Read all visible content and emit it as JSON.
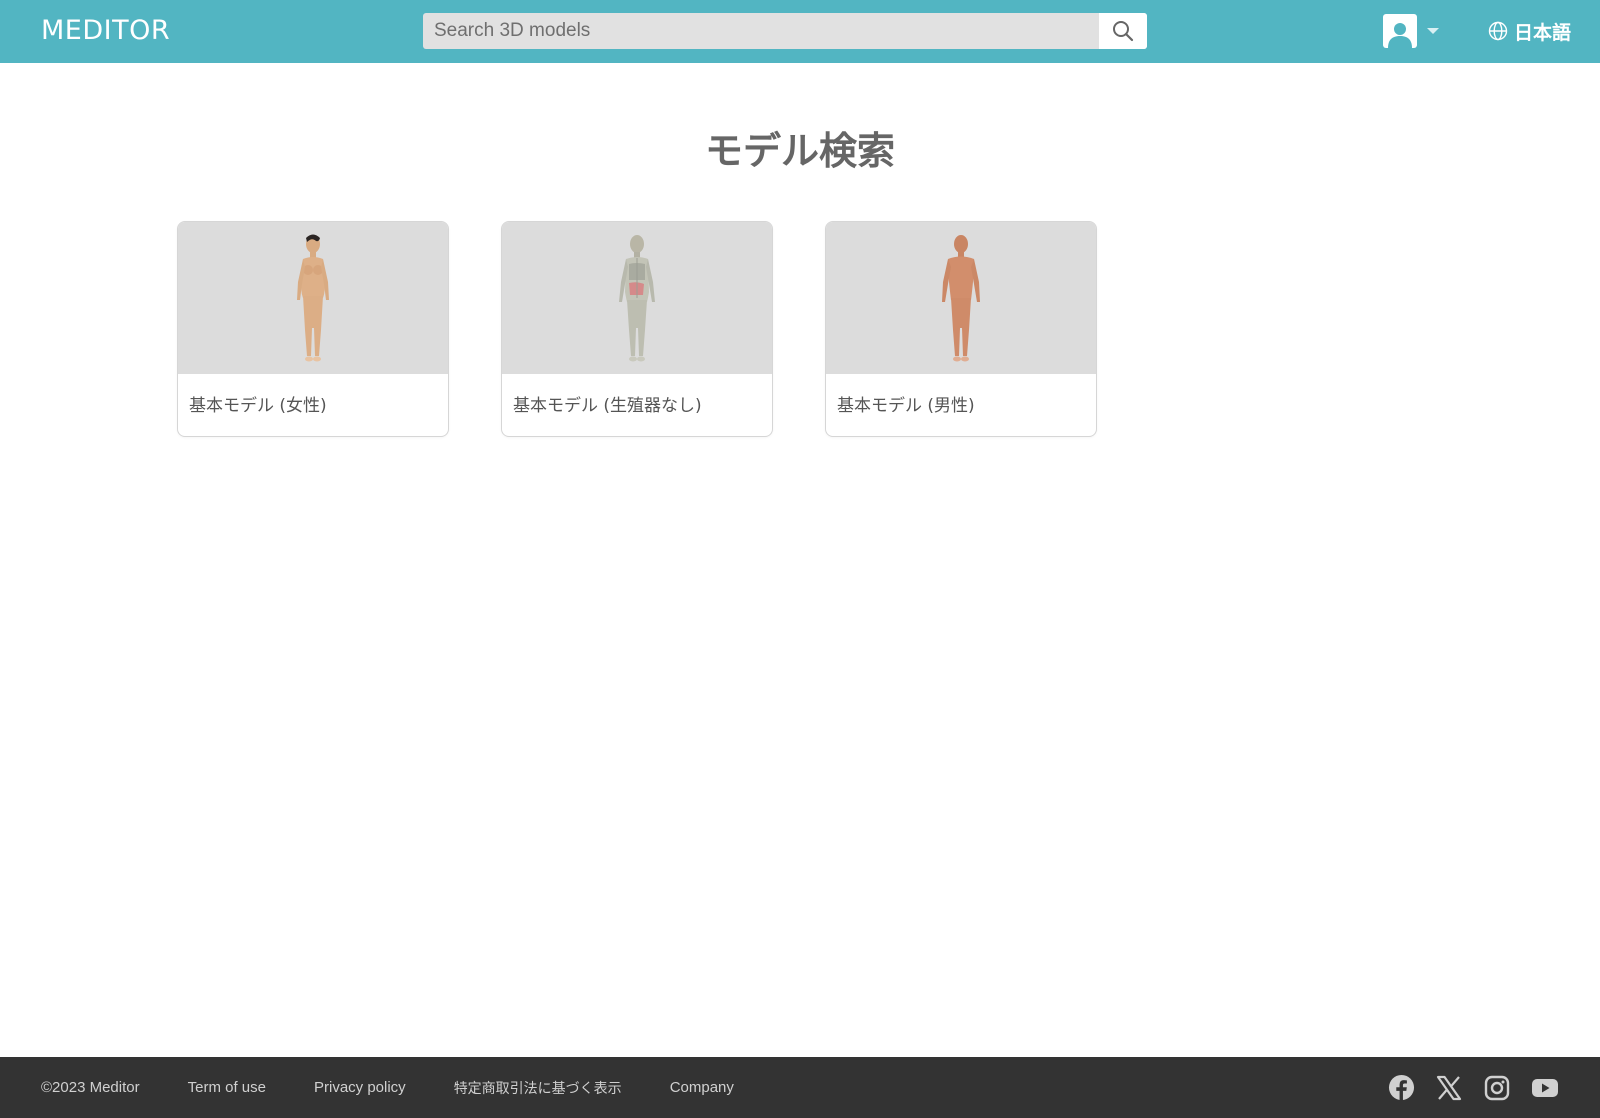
{
  "header": {
    "logo": "MEDITOR",
    "search": {
      "placeholder": "Search 3D models",
      "value": ""
    },
    "search_button_icon": "search-icon",
    "user_icon": "user-icon",
    "language": "日本語",
    "accent_color": "#52b5c2"
  },
  "main": {
    "title": "モデル検索",
    "cards": [
      {
        "label": "基本モデル (女性)",
        "thumbnail": "female-body-model"
      },
      {
        "label": "基本モデル (生殖器なし)",
        "thumbnail": "anatomy-body-model"
      },
      {
        "label": "基本モデル (男性)",
        "thumbnail": "male-body-model"
      }
    ]
  },
  "footer": {
    "copyright": "©2023 Meditor",
    "links": [
      "Term of use",
      "Privacy policy",
      "特定商取引法に基づく表示",
      "Company"
    ],
    "social_icons": [
      "facebook-icon",
      "x-icon",
      "instagram-icon",
      "youtube-icon"
    ],
    "background": "#333333"
  }
}
